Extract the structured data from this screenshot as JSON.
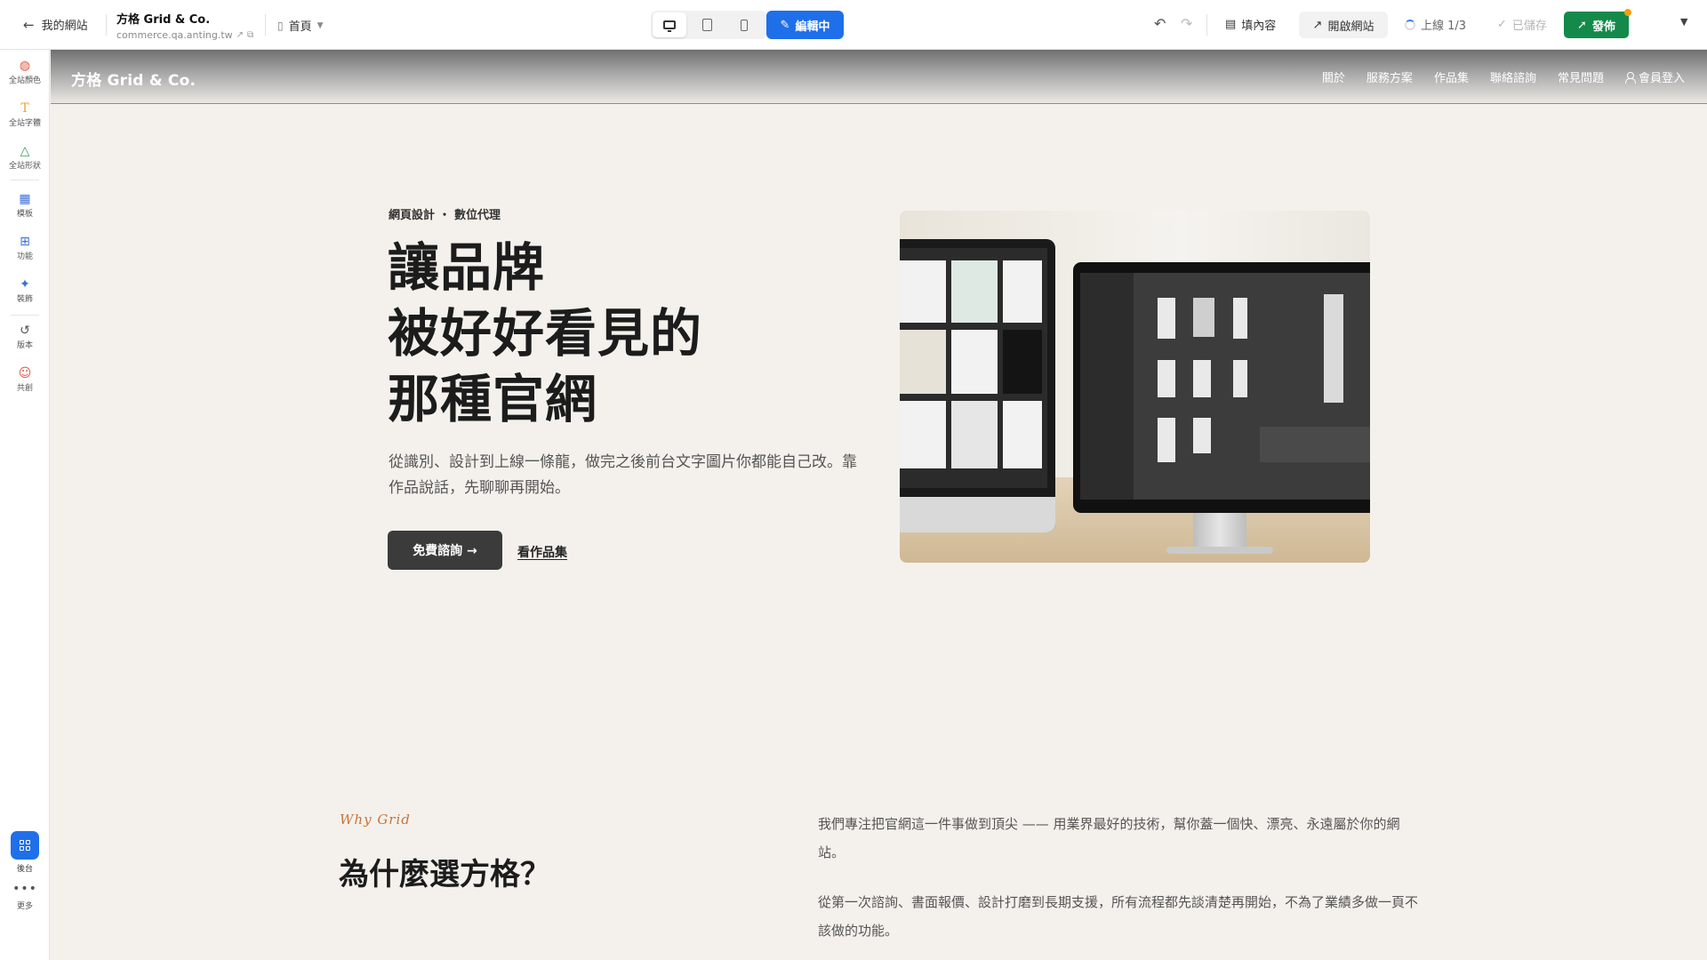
{
  "toolbar": {
    "back_label": "我的網站",
    "site_name": "方格 Grid & Co.",
    "site_url": "commerce.qa.anting.tw",
    "page_selector": "首頁",
    "edit_label": "編輯中",
    "fill_content_label": "填內容",
    "open_site_label": "開啟網站",
    "publish_progress": "上線 1/3",
    "saved_label": "已儲存",
    "publish_label": "發佈"
  },
  "sidebar": {
    "items": [
      {
        "label": "全站顏色",
        "icon": "palette-icon",
        "color": "#e0533d"
      },
      {
        "label": "全站字體",
        "icon": "text-t-icon",
        "color": "#e8a23a"
      },
      {
        "label": "全站形狀",
        "icon": "shapes-icon",
        "color": "#2e9e5b"
      },
      {
        "label": "模板",
        "icon": "layout-icon",
        "color": "#3b6fd8"
      },
      {
        "label": "功能",
        "icon": "widgets-icon",
        "color": "#3b6fd8"
      },
      {
        "label": "裝飾",
        "icon": "sparkle-icon",
        "color": "#3b6fd8"
      },
      {
        "label": "版本",
        "icon": "history-icon",
        "color": "#555555"
      },
      {
        "label": "共創",
        "icon": "collab-icon",
        "color": "#e0533d"
      }
    ],
    "admin_label": "後台",
    "more_label": "更多"
  },
  "site": {
    "logo": "方格 Grid & Co.",
    "nav": [
      "關於",
      "服務方案",
      "作品集",
      "聯絡諮詢",
      "常見問題"
    ],
    "login_label": "會員登入"
  },
  "hero": {
    "eyebrow": "網頁設計 ・ 數位代理",
    "title_lines": [
      "讓品牌",
      "被好好看見的",
      "那種官網"
    ],
    "description": "從識別、設計到上線一條龍，做完之後前台文字圖片你都能自己改。靠作品說話，先聊聊再開始。",
    "cta_label": "免費諮詢 →",
    "link_label": "看作品集"
  },
  "why": {
    "eyebrow": "Why Grid",
    "title": "為什麼選方格？",
    "paragraph1": "我們專注把官網這一件事做到頂尖 —— 用業界最好的技術，幫你蓋一個快、漂亮、永遠屬於你的網站。",
    "paragraph2": "從第一次諮詢、書面報價、設計打磨到長期支援，所有流程都先談清楚再開始，不為了業績多做一頁不該做的功能。"
  },
  "colors": {
    "edit_blue": "#1f6feb",
    "publish_green": "#138a4a",
    "accent_orange": "#c8743a",
    "page_bg": "#f4f1ec"
  }
}
